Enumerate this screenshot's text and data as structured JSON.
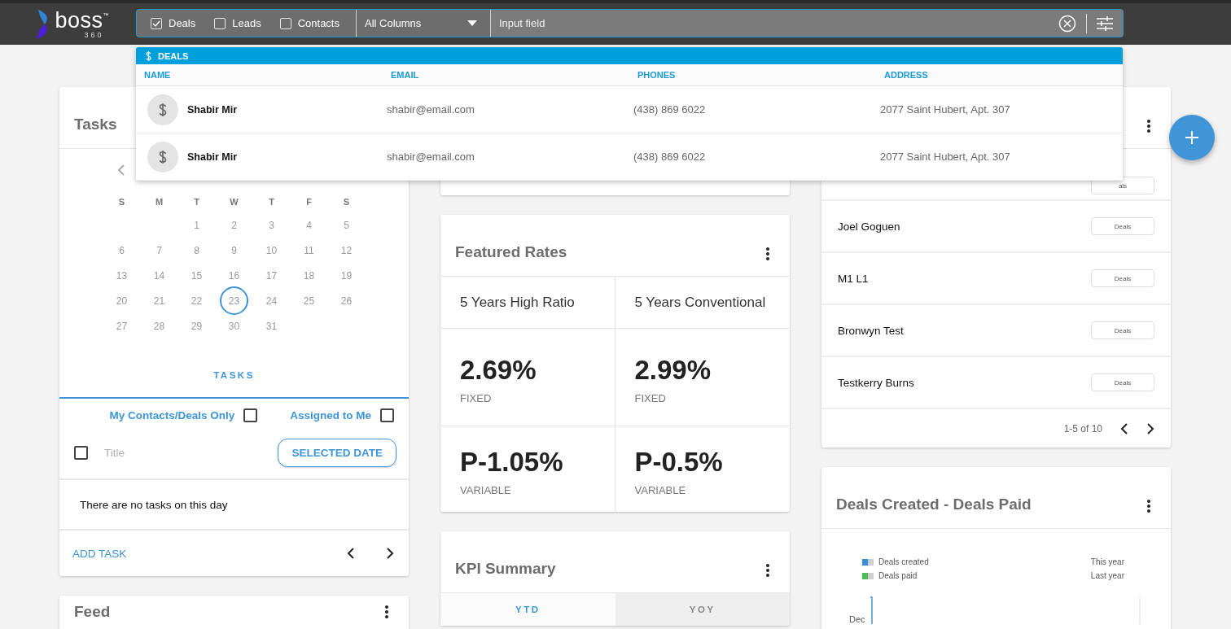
{
  "logo": {
    "name": "boss",
    "mark": "™",
    "sub": "360"
  },
  "search": {
    "filters": [
      {
        "label": "Deals",
        "checked": true
      },
      {
        "label": "Leads",
        "checked": false
      },
      {
        "label": "Contacts",
        "checked": false
      }
    ],
    "column_select": "All Columns",
    "placeholder": "Input field"
  },
  "results": {
    "group": "DEALS",
    "columns": [
      "NAME",
      "EMAIL",
      "PHONES",
      "ADDRESS"
    ],
    "rows": [
      {
        "name": "Shabir Mir",
        "email": "shabir@email.com",
        "phone": "(438) 869 6022",
        "address": "2077 Saint Hubert, Apt. 307"
      },
      {
        "name": "Shabir Mir",
        "email": "shabir@email.com",
        "phone": "(438) 869 6022",
        "address": "2077 Saint Hubert, Apt. 307"
      }
    ]
  },
  "tasks_card": {
    "title": "Tasks",
    "weekdays": [
      "S",
      "M",
      "T",
      "W",
      "T",
      "F",
      "S"
    ],
    "weeks": [
      [
        {
          "day": "1",
          "selected": false
        },
        {
          "day": "2",
          "selected": false
        },
        {
          "day": "3",
          "selected": false
        },
        {
          "day": "4",
          "selected": false
        },
        {
          "day": "5",
          "selected": false
        }
      ],
      [
        {
          "day": "6",
          "selected": false
        },
        {
          "day": "7",
          "selected": false
        },
        {
          "day": "8",
          "selected": false
        },
        {
          "day": "9",
          "selected": false
        },
        {
          "day": "10",
          "selected": false
        },
        {
          "day": "11",
          "selected": false
        },
        {
          "day": "12",
          "selected": false
        }
      ],
      [
        {
          "day": "13",
          "selected": false
        },
        {
          "day": "14",
          "selected": false
        },
        {
          "day": "15",
          "selected": false
        },
        {
          "day": "16",
          "selected": false
        },
        {
          "day": "17",
          "selected": false
        },
        {
          "day": "18",
          "selected": false
        },
        {
          "day": "19",
          "selected": false
        }
      ],
      [
        {
          "day": "20",
          "selected": false
        },
        {
          "day": "21",
          "selected": false
        },
        {
          "day": "22",
          "selected": false
        },
        {
          "day": "23",
          "selected": true
        },
        {
          "day": "24",
          "selected": false
        },
        {
          "day": "25",
          "selected": false
        },
        {
          "day": "26",
          "selected": false
        }
      ],
      [
        {
          "day": "27",
          "selected": false
        },
        {
          "day": "28",
          "selected": false
        },
        {
          "day": "29",
          "selected": false
        },
        {
          "day": "30",
          "selected": false
        },
        {
          "day": "31",
          "selected": false
        }
      ]
    ],
    "tab": "TASKS",
    "filters": [
      {
        "label": "My Contacts/Deals Only",
        "checked": false
      },
      {
        "label": "Assigned to Me",
        "checked": false
      }
    ],
    "list_header": {
      "label": "Title",
      "checked": false
    },
    "date_button": "SELECTED DATE",
    "empty": "There are no tasks on this day",
    "add": "ADD TASK"
  },
  "feed_card": {
    "title": "Feed"
  },
  "rates_card": {
    "title": "Featured Rates",
    "products": [
      {
        "name": "5 Years High Ratio",
        "fixed": "2.69%",
        "fixed_label": "FIXED",
        "variable": "P-1.05%",
        "variable_label": "VARIABLE"
      },
      {
        "name": "5 Years Conventional",
        "fixed": "2.99%",
        "fixed_label": "FIXED",
        "variable": "P-0.5%",
        "variable_label": "VARIABLE"
      }
    ]
  },
  "kpi_card": {
    "title": "KPI Summary",
    "tabs": [
      {
        "label": "YTD",
        "selected": true
      },
      {
        "label": "YOY",
        "selected": false
      }
    ]
  },
  "contacts_card": {
    "rows": [
      {
        "tag": "als"
      },
      {
        "name": "Joel Goguen",
        "tag": "Deals"
      },
      {
        "name": "M1 L1",
        "tag": "Deals"
      },
      {
        "name": "Bronwyn Test",
        "tag": "Deals"
      },
      {
        "name": "Testkerry Burns",
        "tag": "Deals"
      }
    ],
    "pagination": "1-5 of 10"
  },
  "deals_card": {
    "title": "Deals Created - Deals Paid",
    "legend": [
      {
        "label": "Deals created",
        "color": "#3a8fd6"
      },
      {
        "label": "Deals paid",
        "color": "#4cbf57"
      }
    ],
    "periods": [
      "This year",
      "Last year"
    ],
    "axis_label": "Dec"
  }
}
